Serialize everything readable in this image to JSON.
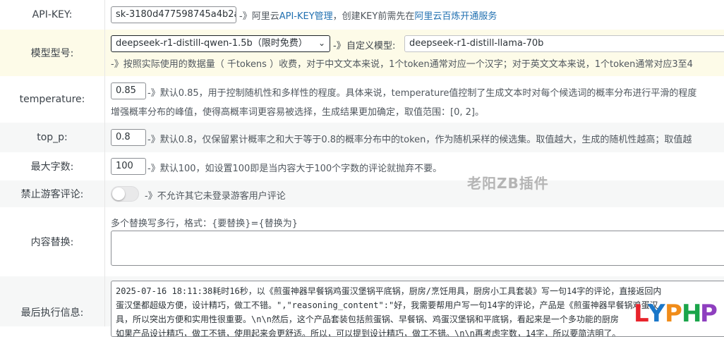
{
  "rows": {
    "api_key": {
      "label": "API-KEY:",
      "value": "sk-3180d477598745a4b2a2",
      "arrow": "-》",
      "text1": "阿里云",
      "link1": "API-KEY管理",
      "text2": "，创建KEY前需先在",
      "link2": "阿里云百炼开通服务"
    },
    "model": {
      "label": "模型型号:",
      "selected": "deepseek-r1-distill-qwen-1.5b（限时免费）",
      "arrow": "-》",
      "custom_label": "自定义模型:",
      "custom_value": "deepseek-r1-distill-llama-70b",
      "desc": "-》按照实际使用的数据量（ 千tokens ）收费，对于中文文本来说，1个token通常对应一个汉字；对于英文文本来说，1个token通常对应3至4"
    },
    "temperature": {
      "label": "temperature:",
      "value": "0.85",
      "desc1": "-》默认0.85，用于控制随机性和多样性的程度。具体来说，temperature值控制了生成文本时对每个候选词的概率分布进行平滑的程度",
      "desc2": "增强概率分布的峰值，使得高概率词更容易被选择，生成结果更加确定，取值范围：[0, 2]。"
    },
    "top_p": {
      "label": "top_p:",
      "value": "0.8",
      "desc": "-》默认0.8，仅保留累计概率之和大于等于0.8的概率分布中的token，作为随机采样的候选集。取值越大，生成的随机性越高；取值越"
    },
    "max_words": {
      "label": "最大字数:",
      "value": "100",
      "desc": "-》默认100，如设置100即是当内容大于100个字数的评论就抛弃不要。"
    },
    "guest": {
      "label": "禁止游客评论:",
      "toggle_on": false,
      "desc": "-》不允许其它未登录游客用户评论"
    },
    "replace": {
      "label": "内容替换:",
      "hint": "多个替换写多行，格式：{要替换}={替换为}"
    },
    "last_run": {
      "label": "最后执行信息:",
      "lines": [
        "2025-07-16 18:11:38耗时16秒，以《煎蛋神器早餐锅鸡蛋汉堡锅平底锅，厨房/烹饪用具，厨房小工具套装》写一句14字的评论，直接返回内",
        "蛋汉堡都超级方便，设计精巧，做工不错。\",\"reasoning_content\":\"好，我需要帮用户写一句14字的评论，产品是《煎蛋神器早餐锅鸡蛋汉",
        "具，所以突出方便和实用性很重要。\\n\\n然后，这个产品套装包括煎蛋锅、早餐锅、鸡蛋汉堡锅和平底锅，看起来是一个多功能的厨房",
        "如果产品设计精巧，做工不错，使用起来会更舒适。所以，可以提到设计精巧，做工不错。\\n\\n再考虑字数，14字，所以要简洁明了。"
      ]
    }
  },
  "watermark": "老阳ZB插件",
  "logo": "LYPHP"
}
